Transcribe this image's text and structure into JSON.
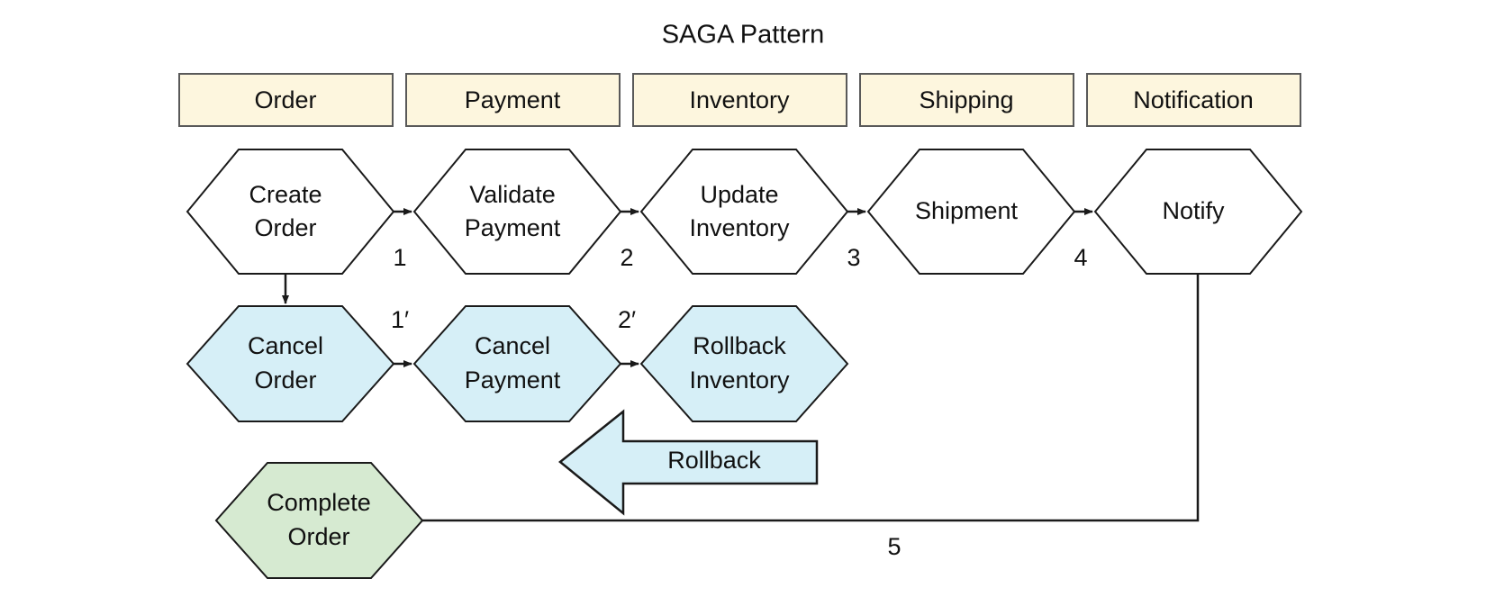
{
  "title": "SAGA Pattern",
  "colors": {
    "lane_fill": "#fdf6de",
    "lane_stroke": "#595959",
    "forward_node_fill": "#ffffff",
    "compensation_node_fill": "#d6eff7",
    "success_node_fill": "#d6ead1",
    "stroke": "#1a1a1a",
    "background": "#ffffff"
  },
  "lanes": [
    {
      "label": "Order"
    },
    {
      "label": "Payment"
    },
    {
      "label": "Inventory"
    },
    {
      "label": "Shipping"
    },
    {
      "label": "Notification"
    }
  ],
  "forward_path": {
    "nodes": [
      {
        "line1": "Create",
        "line2": "Order"
      },
      {
        "line1": "Validate",
        "line2": "Payment"
      },
      {
        "line1": "Update",
        "line2": "Inventory"
      },
      {
        "line1": "Shipment",
        "line2": ""
      },
      {
        "line1": "Notify",
        "line2": ""
      }
    ],
    "edge_labels": [
      "1",
      "2",
      "3",
      "4"
    ]
  },
  "compensation_path": {
    "nodes": [
      {
        "line1": "Cancel",
        "line2": "Order"
      },
      {
        "line1": "Cancel",
        "line2": "Payment"
      },
      {
        "line1": "Rollback",
        "line2": "Inventory"
      }
    ],
    "edge_labels": [
      "1′",
      "2′"
    ]
  },
  "rollback_arrow": {
    "label": "Rollback"
  },
  "completion": {
    "node": {
      "line1": "Complete",
      "line2": "Order"
    },
    "edge_label": "5"
  }
}
